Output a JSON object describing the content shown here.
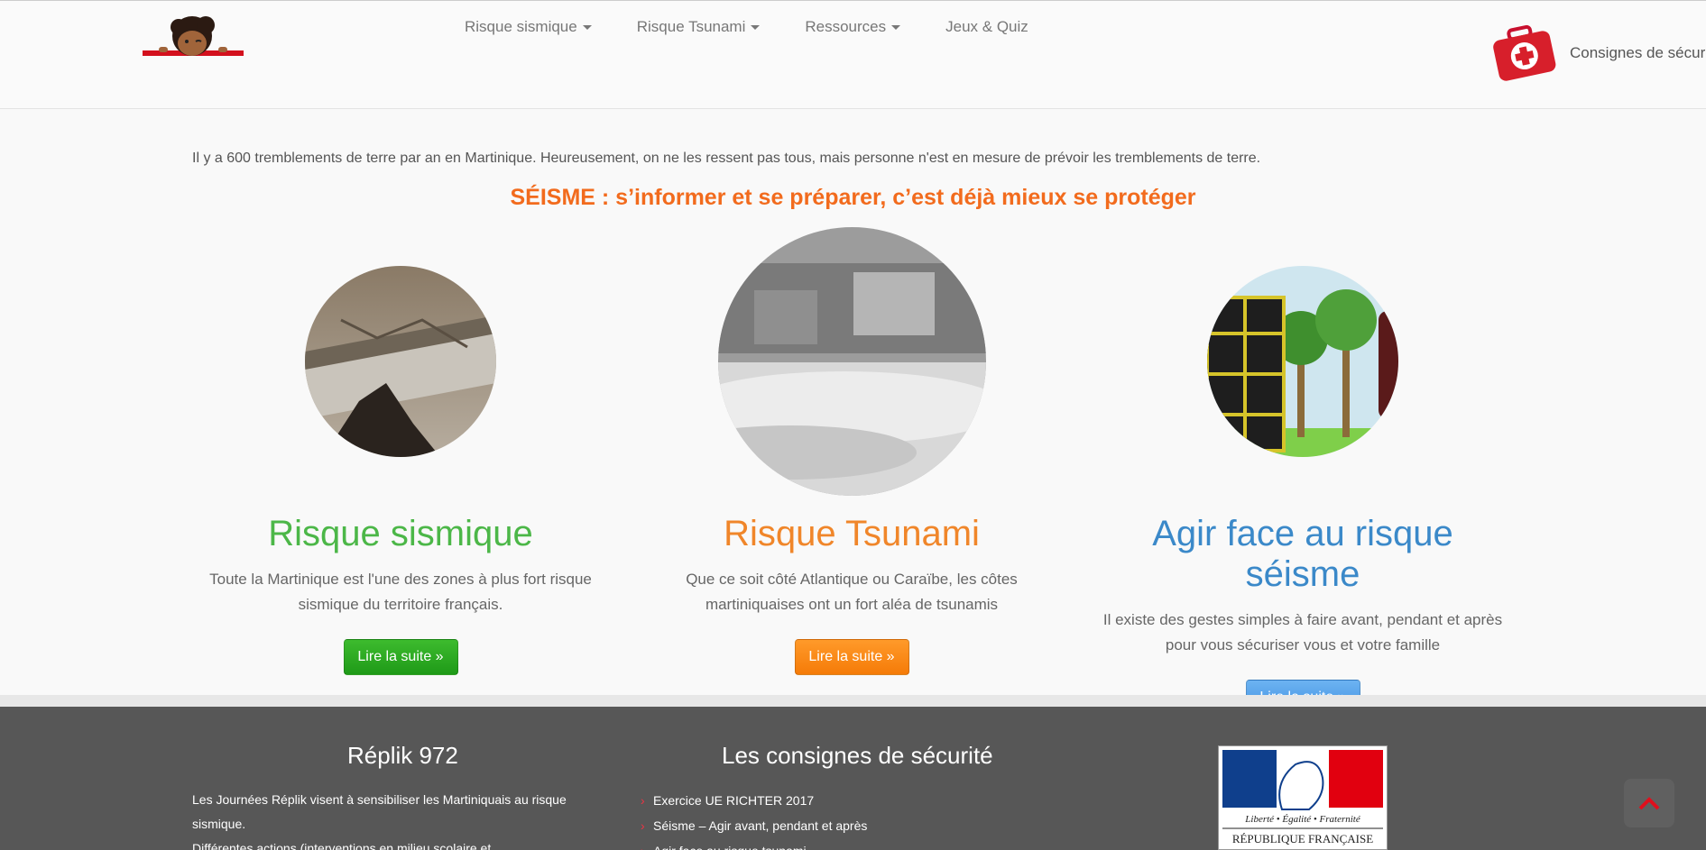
{
  "nav": {
    "items": [
      {
        "label": "Risque sismique",
        "has_dropdown": true
      },
      {
        "label": "Risque Tsunami",
        "has_dropdown": true
      },
      {
        "label": "Ressources",
        "has_dropdown": true
      },
      {
        "label": "Jeux & Quiz",
        "has_dropdown": false
      }
    ],
    "consignes_label": "Consignes de sécurit"
  },
  "main": {
    "intro": "Il y a 600 tremblements de terre par an en Martinique. Heureusement, on ne les ressent pas tous, mais personne n'est en mesure de prévoir les tremblements de terre.",
    "headline": "SÉISME : s’informer et se préparer, c’est déjà mieux se protéger",
    "columns": [
      {
        "title": "Risque sismique",
        "text": "Toute la Martinique est l'une des zones à plus fort risque sismique du territoire français.",
        "button": "Lire la suite »",
        "color": "#4cb748"
      },
      {
        "title": "Risque Tsunami",
        "text": "Que ce soit côté Atlantique ou Caraïbe, les côtes martiniquaises ont un fort aléa de tsunamis",
        "button": "Lire la suite »",
        "color": "#f0862a"
      },
      {
        "title": "Agir face au risque séisme",
        "text": "Il existe des gestes simples à faire avant, pendant et après pour vous sécuriser vous et votre famille",
        "button": "Lire la suite »",
        "color": "#3b89c9"
      }
    ]
  },
  "footer": {
    "col1_title": "Réplik 972",
    "col1_text": "Les Journées Réplik visent à sensibiliser les Martiniquais au risque sismique.",
    "col1_text2": "Différentes actions (interventions en milieu scolaire et",
    "col2_title": "Les consignes de sécurité",
    "col2_links": [
      "Exercice UE RICHTER 2017",
      "Séisme – Agir avant, pendant et après",
      "Agir face au risque tsunami"
    ],
    "marianne_motto": "Liberté • Égalité • Fraternité",
    "marianne_name": "RÉPUBLIQUE FRANÇAISE"
  },
  "colors": {
    "accent": "#f26b1d",
    "footer_bg": "#575757"
  }
}
